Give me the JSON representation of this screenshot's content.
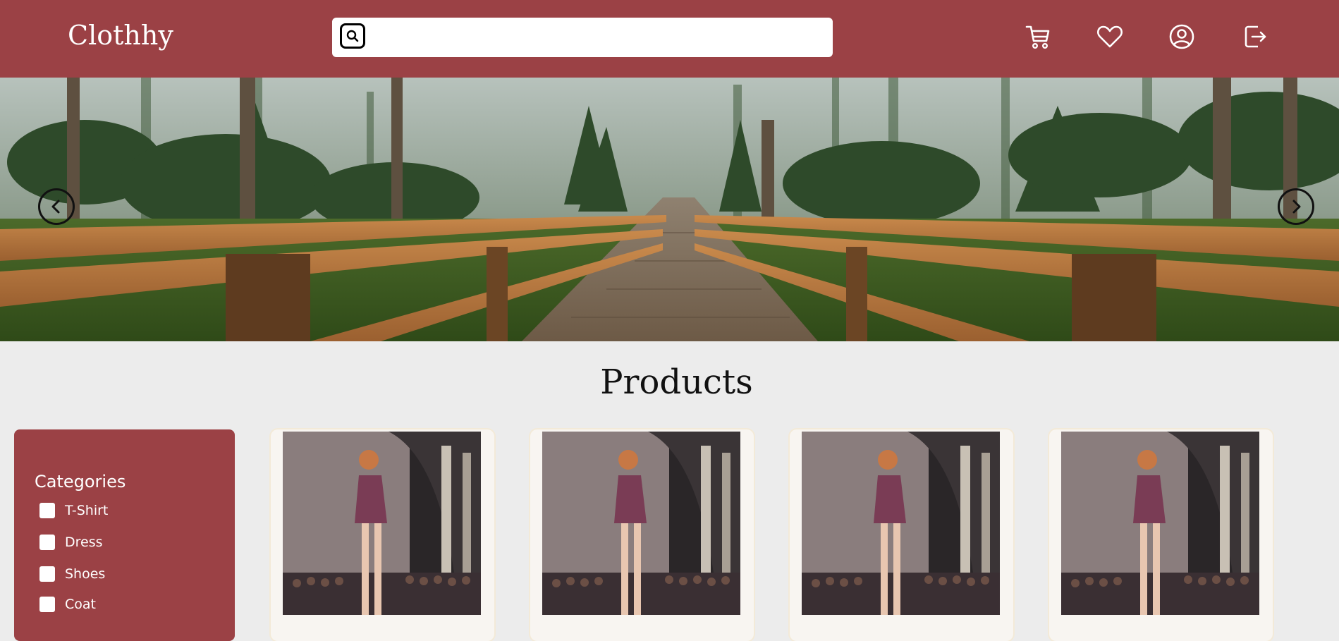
{
  "header": {
    "logo": "Clothhy",
    "search": {
      "placeholder": "",
      "value": ""
    },
    "icons": [
      "cart-icon",
      "heart-icon",
      "user-icon",
      "logout-icon"
    ]
  },
  "hero": {
    "image": "forest-boardwalk-banner",
    "prev_icon": "chevron-left-icon",
    "next_icon": "chevron-right-icon"
  },
  "products": {
    "title": "Products",
    "items": [
      {
        "image": "runway-model-purple-dress"
      },
      {
        "image": "runway-model-purple-dress"
      },
      {
        "image": "runway-model-purple-dress"
      },
      {
        "image": "runway-model-purple-dress"
      }
    ]
  },
  "sidebar": {
    "title": "Categories",
    "categories": [
      {
        "label": "T-Shirt",
        "checked": false
      },
      {
        "label": "Dress",
        "checked": false
      },
      {
        "label": "Shoes",
        "checked": false
      },
      {
        "label": "Coat",
        "checked": false
      }
    ]
  },
  "colors": {
    "brand": "#9b4145",
    "background": "#ececec",
    "card": "#f8f5f1"
  }
}
